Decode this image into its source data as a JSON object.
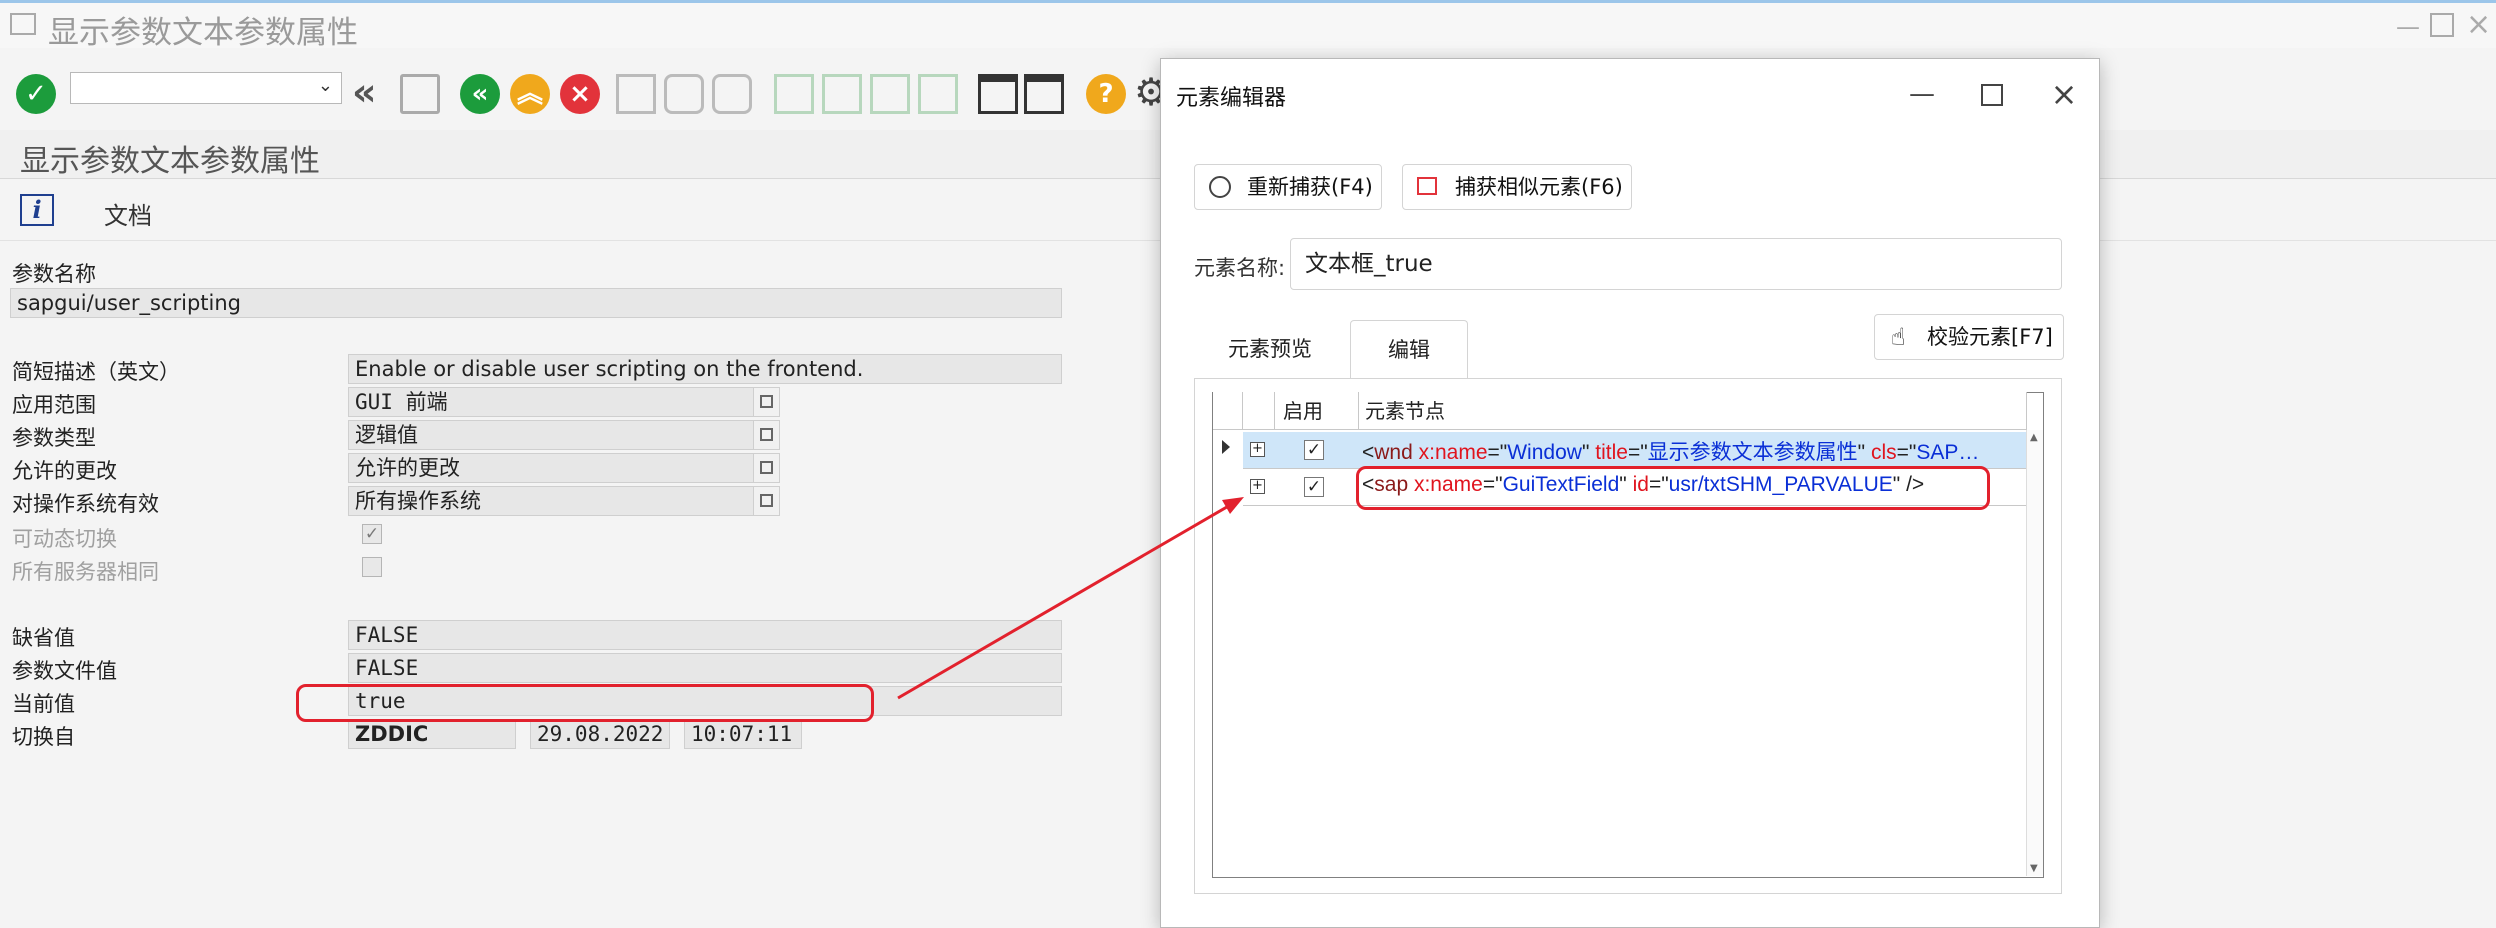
{
  "sap": {
    "window_title": "显示参数文本参数属性",
    "header_title": "显示参数文本参数属性",
    "appbar": {
      "doc_label": "文档"
    },
    "param_name_label": "参数名称",
    "param_name_value": "sapgui/user_scripting",
    "fields": [
      {
        "label": "简短描述（英文）",
        "value": "Enable or disable user scripting on the frontend."
      },
      {
        "label": "应用范围",
        "value": "GUI 前端"
      },
      {
        "label": "参数类型",
        "value": "逻辑值"
      },
      {
        "label": "允许的更改",
        "value": "允许的更改"
      },
      {
        "label": "对操作系统有效",
        "value": "所有操作系统"
      }
    ],
    "checkboxes": [
      {
        "label": "可动态切换",
        "checked": true
      },
      {
        "label": "所有服务器相同",
        "checked": false
      }
    ],
    "values": [
      {
        "label": "缺省值",
        "value": "FALSE"
      },
      {
        "label": "参数文件值",
        "value": "FALSE"
      },
      {
        "label": "当前值",
        "value": "true"
      }
    ],
    "switched_from": {
      "label": "切换自",
      "user": "ZDDIC",
      "date": "29.08.2022",
      "time": "10:07:11"
    }
  },
  "dialog": {
    "title": "元素编辑器",
    "recapture_button": "重新捕获(F4)",
    "capture_similar_button": "捕获相似元素(F6)",
    "name_label": "元素名称:",
    "name_value": "文本框_true",
    "tabs": [
      "元素预览",
      "编辑"
    ],
    "active_tab": "编辑",
    "verify_button": "校验元素[F7]",
    "grid": {
      "headers": [
        "启用",
        "元素节点"
      ],
      "rows": [
        {
          "enabled": true,
          "tag": "wnd",
          "attrs": [
            [
              "x:name",
              "Window"
            ],
            [
              "title",
              "显示参数文本参数属性"
            ],
            [
              "cls",
              "SAP…"
            ]
          ],
          "close": ""
        },
        {
          "enabled": true,
          "tag": "sap",
          "attrs": [
            [
              "x:name",
              "GuiTextField"
            ],
            [
              "id",
              "usr/txtSHM_PARVALUE"
            ]
          ],
          "close": "/>"
        }
      ]
    }
  },
  "colors": {
    "highlight": "#e2212d",
    "green": "#1c9c3c",
    "orange": "#f0a81c",
    "red": "#e2333b"
  }
}
